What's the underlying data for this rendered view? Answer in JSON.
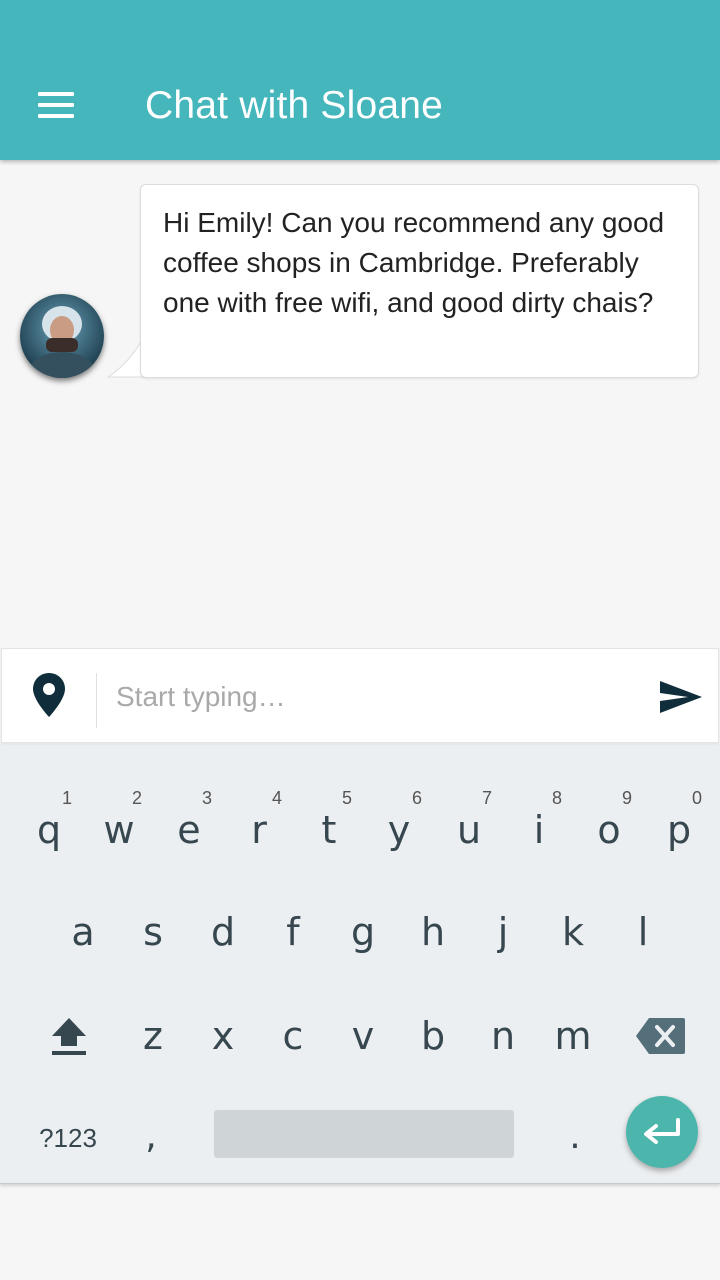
{
  "header": {
    "title": "Chat with Sloane"
  },
  "chat": {
    "messages": [
      {
        "text": "Hi Emily! Can you recommend any good coffee shops in Cambridge. Preferably one with free wifi, and good dirty chais?"
      }
    ]
  },
  "composer": {
    "placeholder": "Start typing…"
  },
  "keyboard": {
    "row1": [
      {
        "ch": "q",
        "hint": "1"
      },
      {
        "ch": "w",
        "hint": "2"
      },
      {
        "ch": "e",
        "hint": "3"
      },
      {
        "ch": "r",
        "hint": "4"
      },
      {
        "ch": "t",
        "hint": "5"
      },
      {
        "ch": "y",
        "hint": "6"
      },
      {
        "ch": "u",
        "hint": "7"
      },
      {
        "ch": "i",
        "hint": "8"
      },
      {
        "ch": "o",
        "hint": "9"
      },
      {
        "ch": "p",
        "hint": "0"
      }
    ],
    "row2": [
      "a",
      "s",
      "d",
      "f",
      "g",
      "h",
      "j",
      "k",
      "l"
    ],
    "row3": [
      "z",
      "x",
      "c",
      "v",
      "b",
      "n",
      "m"
    ],
    "symbols_label": "?123",
    "comma": ",",
    "period": "."
  },
  "colors": {
    "appbar": "#44b6bc",
    "enter_key": "#4db6ac",
    "icon_dark": "#0f2d3a"
  }
}
